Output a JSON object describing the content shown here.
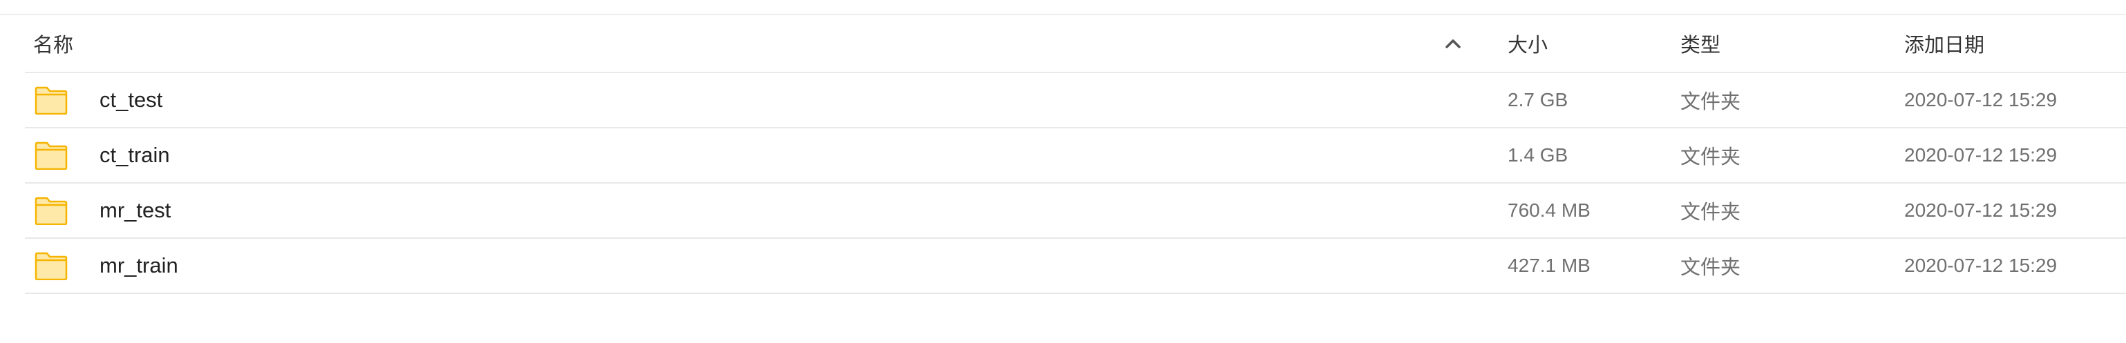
{
  "table": {
    "headers": {
      "name": "名称",
      "size": "大小",
      "type": "类型",
      "date": "添加日期"
    },
    "sort": {
      "column": "name",
      "direction": "ascending",
      "icon": "chevron-up-icon"
    },
    "rows": [
      {
        "name": "ct_test",
        "size": "2.7 GB",
        "type": "文件夹",
        "date": "2020-07-12 15:29",
        "icon": "folder-icon"
      },
      {
        "name": "ct_train",
        "size": "1.4 GB",
        "type": "文件夹",
        "date": "2020-07-12 15:29",
        "icon": "folder-icon"
      },
      {
        "name": "mr_test",
        "size": "760.4 MB",
        "type": "文件夹",
        "date": "2020-07-12 15:29",
        "icon": "folder-icon"
      },
      {
        "name": "mr_train",
        "size": "427.1 MB",
        "type": "文件夹",
        "date": "2020-07-12 15:29",
        "icon": "folder-icon"
      }
    ]
  },
  "colors": {
    "folder_fill": "#FFE9A8",
    "folder_stroke": "#F5B400",
    "divider": "#E8E8E8",
    "muted_text": "#707070"
  }
}
